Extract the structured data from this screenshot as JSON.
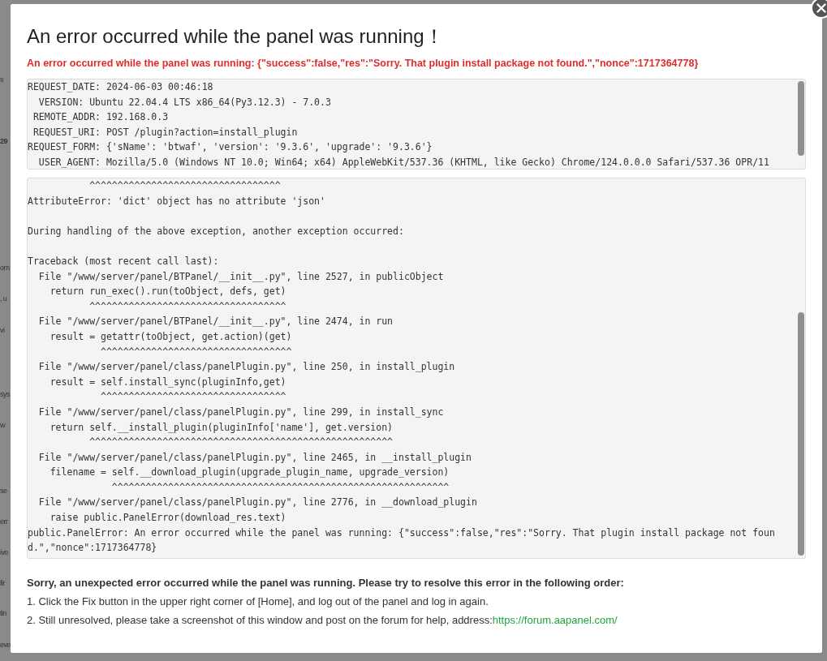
{
  "background_fragments": [
    "s",
    "29",
    "om",
    ", u",
    "vi",
    "sys",
    "w",
    "se",
    "err",
    "ive",
    "fir",
    "tin",
    "eve"
  ],
  "dialog": {
    "title": "An error occurred while the panel was running！",
    "error_message": "An error occurred while the panel was running: {\"success\":false,\"res\":\"Sorry. That plugin install package not found.\",\"nonce\":1717364778}",
    "request_info": [
      "REQUEST_DATE: 2024-06-03 00:46:18",
      "  VERSION: Ubuntu 22.04.4 LTS x86_64(Py3.12.3) - 7.0.3",
      " REMOTE_ADDR: 192.168.0.3",
      " REQUEST_URI: POST /plugin?action=install_plugin",
      "REQUEST_FORM: {'sName': 'btwaf', 'version': '9.3.6', 'upgrade': '9.3.6'}",
      "  USER_AGENT: Mozilla/5.0 (Windows NT 10.0; Win64; x64) AppleWebKit/537.36 (KHTML, like Gecko) Chrome/124.0.0.0 Safari/537.36 OPR/11"
    ],
    "traceback": [
      {
        "text": "           ^^^^^^^^^^^^^^^^^^^^^^^^^^^^^^^^^^",
        "space_before": false
      },
      {
        "text": "AttributeError: 'dict' object has no attribute 'json'",
        "space_before": false
      },
      {
        "text": "During handling of the above exception, another exception occurred:",
        "space_before": true
      },
      {
        "text": "Traceback (most recent call last):",
        "space_before": true
      },
      {
        "text": "  File \"/www/server/panel/BTPanel/__init__.py\", line 2527, in publicObject",
        "space_before": false
      },
      {
        "text": "    return run_exec().run(toObject, defs, get)",
        "space_before": false
      },
      {
        "text": "           ^^^^^^^^^^^^^^^^^^^^^^^^^^^^^^^^^^^",
        "space_before": false
      },
      {
        "text": "  File \"/www/server/panel/BTPanel/__init__.py\", line 2474, in run",
        "space_before": false
      },
      {
        "text": "    result = getattr(toObject, get.action)(get)",
        "space_before": false
      },
      {
        "text": "             ^^^^^^^^^^^^^^^^^^^^^^^^^^^^^^^^^^",
        "space_before": false
      },
      {
        "text": "  File \"/www/server/panel/class/panelPlugin.py\", line 250, in install_plugin",
        "space_before": false
      },
      {
        "text": "    result = self.install_sync(pluginInfo,get)",
        "space_before": false
      },
      {
        "text": "             ^^^^^^^^^^^^^^^^^^^^^^^^^^^^^^^^^",
        "space_before": false
      },
      {
        "text": "  File \"/www/server/panel/class/panelPlugin.py\", line 299, in install_sync",
        "space_before": false
      },
      {
        "text": "    return self.__install_plugin(pluginInfo['name'], get.version)",
        "space_before": false
      },
      {
        "text": "           ^^^^^^^^^^^^^^^^^^^^^^^^^^^^^^^^^^^^^^^^^^^^^^^^^^^^^^",
        "space_before": false
      },
      {
        "text": "  File \"/www/server/panel/class/panelPlugin.py\", line 2465, in __install_plugin",
        "space_before": false
      },
      {
        "text": "    filename = self.__download_plugin(upgrade_plugin_name, upgrade_version)",
        "space_before": false
      },
      {
        "text": "               ^^^^^^^^^^^^^^^^^^^^^^^^^^^^^^^^^^^^^^^^^^^^^^^^^^^^^^^^^^^^",
        "space_before": false
      },
      {
        "text": "  File \"/www/server/panel/class/panelPlugin.py\", line 2776, in __download_plugin",
        "space_before": false
      },
      {
        "text": "    raise public.PanelError(download_res.text)",
        "space_before": false
      },
      {
        "text": "public.PanelError: An error occurred while the panel was running: {\"success\":false,\"res\":\"Sorry. That plugin install package not found.\",\"nonce\":1717364778}",
        "space_before": false
      }
    ],
    "help": {
      "heading": "Sorry, an unexpected error occurred while the panel was running. Please try to resolve this error in the following order:",
      "steps": [
        {
          "text": "1. Click the Fix button in the upper right corner of [Home], and log out of the panel and log in again."
        },
        {
          "text": "2. Still unresolved, please take a screenshot of this window and post on the forum for help, address:",
          "link": "https://forum.aapanel.com/"
        }
      ]
    }
  }
}
